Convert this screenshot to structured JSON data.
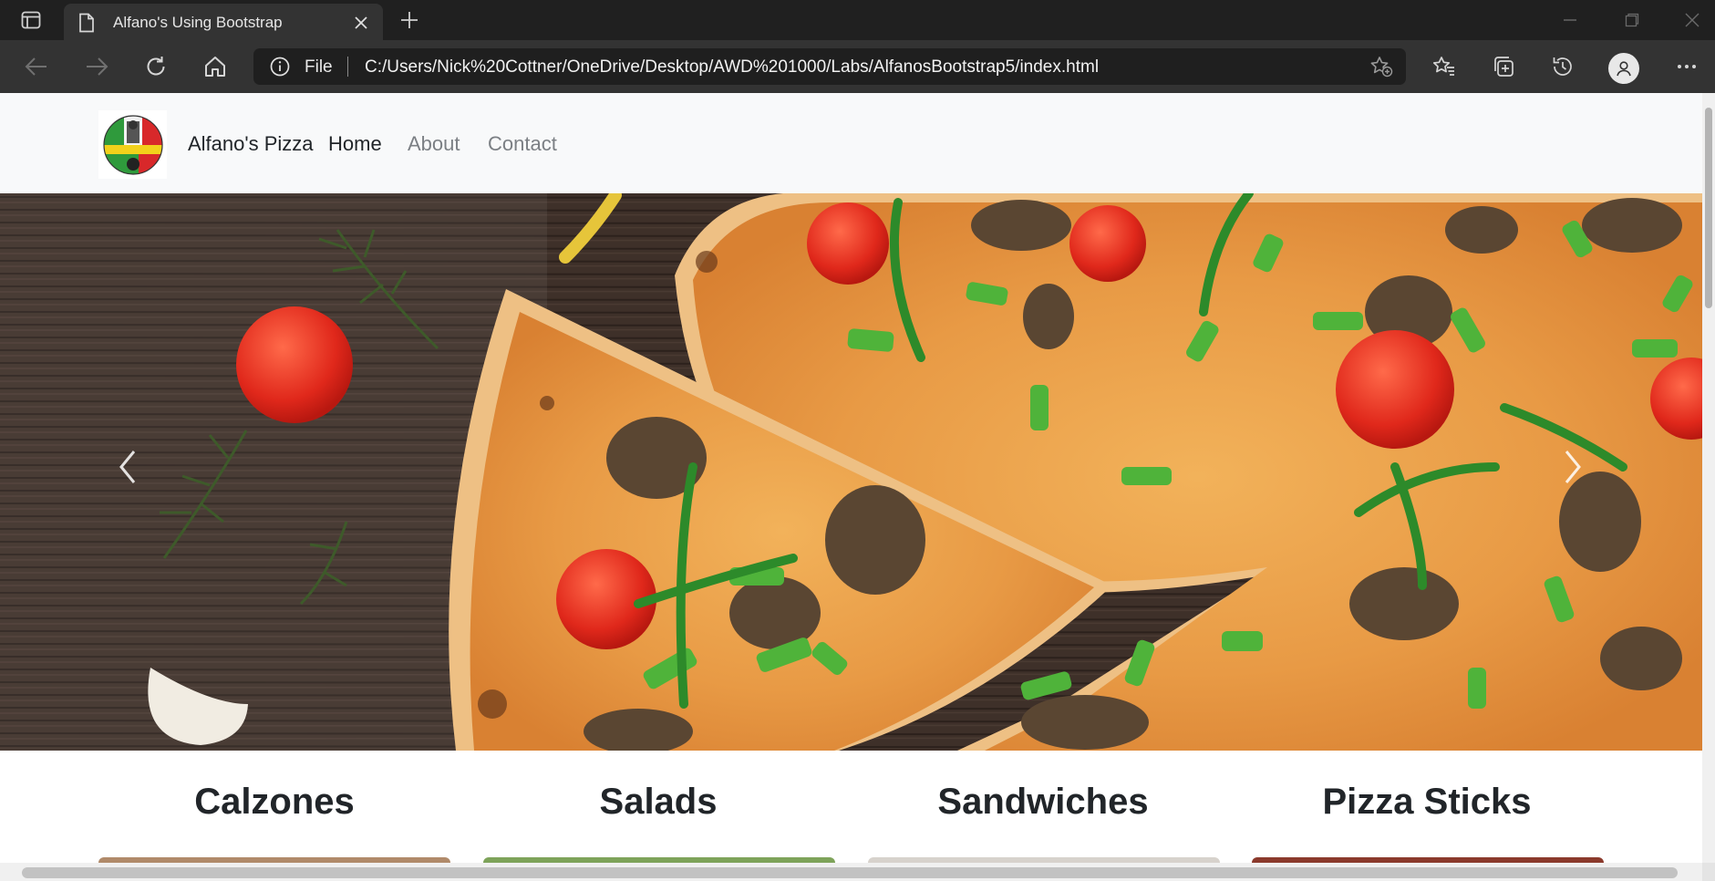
{
  "browser": {
    "tab": {
      "title": "Alfano's Using Bootstrap"
    },
    "address": {
      "scheme_label": "File",
      "url": "C:/Users/Nick%20Cottner/OneDrive/Desktop/AWD%201000/Labs/AlfanosBootstrap5/index.html"
    },
    "icons": {
      "tab_actions": "tab-actions-icon",
      "page": "page-icon",
      "close_tab": "close-icon",
      "new_tab": "plus-icon",
      "back": "back-arrow-icon",
      "forward": "forward-arrow-icon",
      "refresh": "refresh-icon",
      "home": "home-icon",
      "info": "info-icon",
      "add_favorite": "add-favorite-icon",
      "favorites": "favorites-icon",
      "collections": "collections-icon",
      "history": "history-icon",
      "profile": "profile-icon",
      "more": "more-icon"
    }
  },
  "page": {
    "navbar": {
      "brand": "Alfano's Pizza",
      "links": [
        {
          "label": "Home",
          "active": true
        },
        {
          "label": "About",
          "active": false
        },
        {
          "label": "Contact",
          "active": false
        }
      ]
    },
    "carousel": {
      "prev_icon": "chevron-left-icon",
      "next_icon": "chevron-right-icon"
    },
    "cards": [
      {
        "title": "Calzones"
      },
      {
        "title": "Salads"
      },
      {
        "title": "Sandwiches"
      },
      {
        "title": "Pizza Sticks"
      }
    ]
  },
  "colors": {
    "chrome_dark": "#202020",
    "toolbar": "#333333",
    "navbar_bg": "#f8f9fa",
    "text_dark": "#212529",
    "text_muted": "#7b7f84"
  }
}
